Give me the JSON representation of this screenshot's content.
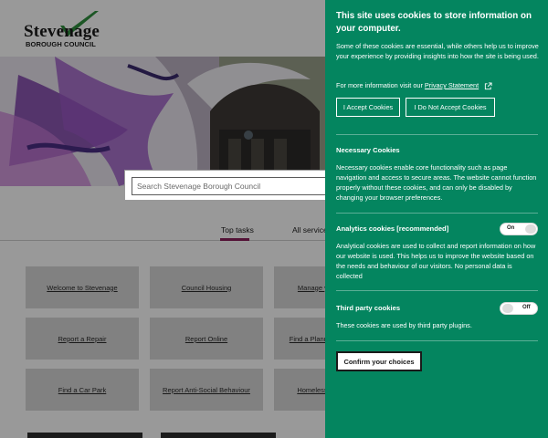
{
  "site": {
    "logo_word": "Stevenage",
    "logo_sub": "BOROUGH COUNCIL"
  },
  "search": {
    "placeholder": "Search Stevenage Borough Council"
  },
  "tabs": [
    {
      "label": "Top tasks",
      "active": true
    },
    {
      "label": "All services",
      "active": false
    }
  ],
  "tiles": [
    "Welcome to Stevenage",
    "Council Housing",
    "Manage your account",
    "Report a Repair",
    "Report Online",
    "Find a Planning Application",
    "Find a Car Park",
    "Report Anti-Social Behaviour",
    "Homelessness Advice"
  ],
  "cookies": {
    "title": "This site uses cookies to store information on your computer.",
    "intro": "Some of these cookies are essential, while others help us to improve your experience by providing insights into how the site is being used.",
    "more_prefix": "For more information visit our",
    "privacy_link": "Privacy Statement",
    "accept_label": "I Accept Cookies",
    "reject_label": "I Do Not Accept Cookies",
    "necessary_title": "Necessary Cookies",
    "necessary_body": "Necessary cookies enable core functionality such as page navigation and access to secure areas. The website cannot function properly without these cookies, and can only be disabled by changing your browser preferences.",
    "analytics_title": "Analytics cookies [recommended]",
    "analytics_toggle": "On",
    "analytics_body": "Analytical cookies are used to collect and report information on how our website is used. This helps us to improve the website based on the needs and behaviour of our visitors. No personal data is collected",
    "third_title": "Third party cookies",
    "third_toggle": "Off",
    "third_body": "These cookies are used by third party plugins.",
    "confirm_label": "Confirm your choices"
  },
  "colors": {
    "panel_green": "#04855f",
    "search_button": "#04795a",
    "active_tab_underline": "#8b1e5b"
  }
}
